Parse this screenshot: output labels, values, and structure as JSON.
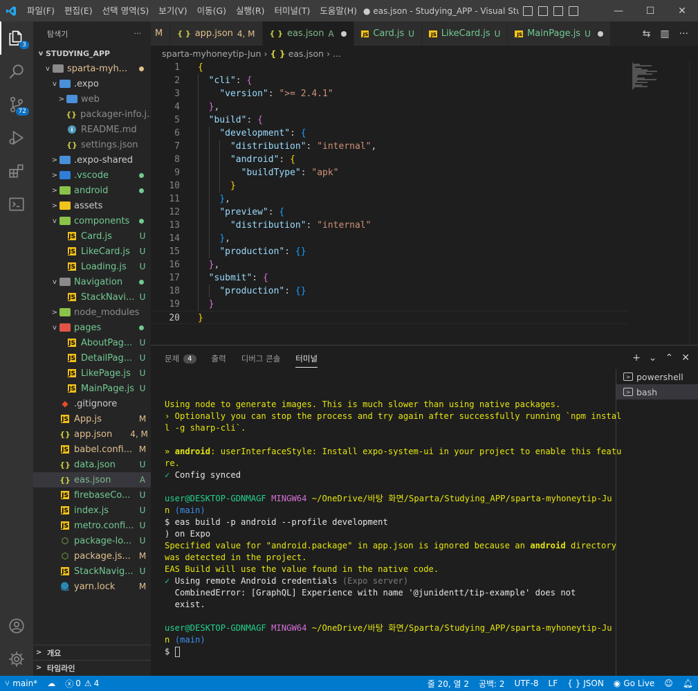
{
  "titlebar": {
    "menu": [
      "파일(F)",
      "편집(E)",
      "선택 영역(S)",
      "보기(V)",
      "이동(G)",
      "실행(R)",
      "터미널(T)",
      "도움말(H)"
    ],
    "window_title": "● eas.json - Studying_APP - Visual Studio C..."
  },
  "activity": {
    "explorer_badge": "3",
    "scm_badge": "72"
  },
  "sidebar": {
    "title": "탐색기",
    "more": "···",
    "project": "STUDYING_APP",
    "items": [
      {
        "twist": "v",
        "icon": "folder",
        "color": "#8a8a8a",
        "label": "sparta-myh...",
        "status": "",
        "dot": "#e2c08d",
        "indent": 1,
        "cls": "c-mod"
      },
      {
        "twist": "v",
        "icon": "folder",
        "color": "#4a90d9",
        "label": ".expo",
        "status": "",
        "indent": 2,
        "cls": "c-white"
      },
      {
        "twist": ">",
        "icon": "folder",
        "color": "#4a90d9",
        "label": "web",
        "status": "",
        "indent": 3,
        "cls": "c-gray"
      },
      {
        "twist": "",
        "icon": "json",
        "label": "packager-info.j...",
        "status": "",
        "indent": 3,
        "cls": "c-gray"
      },
      {
        "twist": "",
        "icon": "info",
        "label": "README.md",
        "status": "",
        "indent": 3,
        "cls": "c-gray"
      },
      {
        "twist": "",
        "icon": "json",
        "label": "settings.json",
        "status": "",
        "indent": 3,
        "cls": "c-gray"
      },
      {
        "twist": ">",
        "icon": "folder",
        "color": "#4a90d9",
        "label": ".expo-shared",
        "status": "",
        "indent": 2,
        "cls": "c-white"
      },
      {
        "twist": ">",
        "icon": "folder",
        "color": "#2f7ed8",
        "label": ".vscode",
        "status": "",
        "dot": "#73c991",
        "indent": 2,
        "cls": "c-unt"
      },
      {
        "twist": ">",
        "icon": "folder",
        "color": "#8bc34a",
        "label": "android",
        "status": "",
        "dot": "#73c991",
        "indent": 2,
        "cls": "c-unt"
      },
      {
        "twist": ">",
        "icon": "folder",
        "color": "#f1c21b",
        "label": "assets",
        "status": "",
        "indent": 2,
        "cls": "c-white"
      },
      {
        "twist": "v",
        "icon": "folder",
        "color": "#8bc34a",
        "label": "components",
        "status": "",
        "dot": "#73c991",
        "indent": 2,
        "cls": "c-unt"
      },
      {
        "twist": "",
        "icon": "js",
        "label": "Card.js",
        "status": "U",
        "indent": 3,
        "cls": "c-unt"
      },
      {
        "twist": "",
        "icon": "js",
        "label": "LikeCard.js",
        "status": "U",
        "indent": 3,
        "cls": "c-unt"
      },
      {
        "twist": "",
        "icon": "js",
        "label": "Loading.js",
        "status": "U",
        "indent": 3,
        "cls": "c-unt"
      },
      {
        "twist": "v",
        "icon": "folder",
        "color": "#8a8a8a",
        "label": "Navigation",
        "status": "",
        "dot": "#73c991",
        "indent": 2,
        "cls": "c-unt"
      },
      {
        "twist": "",
        "icon": "js",
        "label": "StackNavi...",
        "status": "U",
        "indent": 3,
        "cls": "c-unt"
      },
      {
        "twist": ">",
        "icon": "folder",
        "color": "#8bc34a",
        "label": "node_modules",
        "status": "",
        "indent": 2,
        "cls": "c-gray"
      },
      {
        "twist": "v",
        "icon": "folder",
        "color": "#e05545",
        "label": "pages",
        "status": "",
        "dot": "#73c991",
        "indent": 2,
        "cls": "c-unt"
      },
      {
        "twist": "",
        "icon": "js",
        "label": "AboutPag...",
        "status": "U",
        "indent": 3,
        "cls": "c-unt"
      },
      {
        "twist": "",
        "icon": "js",
        "label": "DetailPag...",
        "status": "U",
        "indent": 3,
        "cls": "c-unt"
      },
      {
        "twist": "",
        "icon": "js",
        "label": "LikePage.js",
        "status": "U",
        "indent": 3,
        "cls": "c-unt"
      },
      {
        "twist": "",
        "icon": "js",
        "label": "MainPage.js",
        "status": "U",
        "indent": 3,
        "cls": "c-unt"
      },
      {
        "twist": "",
        "icon": "git",
        "label": ".gitignore",
        "status": "",
        "indent": 2,
        "cls": "c-white"
      },
      {
        "twist": "",
        "icon": "js",
        "label": "App.js",
        "status": "M",
        "indent": 2,
        "cls": "c-mod"
      },
      {
        "twist": "",
        "icon": "json",
        "label": "app.json",
        "status": "4, M",
        "indent": 2,
        "cls": "c-mod"
      },
      {
        "twist": "",
        "icon": "js",
        "label": "babel.confi...",
        "status": "M",
        "indent": 2,
        "cls": "c-mod"
      },
      {
        "twist": "",
        "icon": "json",
        "label": "data.json",
        "status": "U",
        "indent": 2,
        "cls": "c-unt"
      },
      {
        "twist": "",
        "icon": "json",
        "label": "eas.json",
        "status": "A",
        "indent": 2,
        "cls": "c-add",
        "selected": true
      },
      {
        "twist": "",
        "icon": "js",
        "label": "firebaseCo...",
        "status": "U",
        "indent": 2,
        "cls": "c-unt"
      },
      {
        "twist": "",
        "icon": "js",
        "label": "index.js",
        "status": "U",
        "indent": 2,
        "cls": "c-unt"
      },
      {
        "twist": "",
        "icon": "js",
        "label": "metro.confi...",
        "status": "U",
        "indent": 2,
        "cls": "c-unt"
      },
      {
        "twist": "",
        "icon": "npm",
        "label": "package-lo...",
        "status": "U",
        "indent": 2,
        "cls": "c-unt"
      },
      {
        "twist": "",
        "icon": "npm",
        "label": "package.js...",
        "status": "M",
        "indent": 2,
        "cls": "c-mod"
      },
      {
        "twist": "",
        "icon": "js",
        "label": "StackNavig...",
        "status": "U",
        "indent": 2,
        "cls": "c-unt"
      },
      {
        "twist": "",
        "icon": "yarn",
        "label": "yarn.lock",
        "status": "M",
        "indent": 2,
        "cls": "c-mod"
      }
    ],
    "outline": "개요",
    "timeline": "타임라인"
  },
  "tabs": [
    {
      "icon": "",
      "label": "M",
      "status": "",
      "cls": "c-mod",
      "partial": true
    },
    {
      "icon": "{ }",
      "label": "app.json",
      "status": "4, M",
      "cls": "c-mod"
    },
    {
      "icon": "{ }",
      "label": "eas.json",
      "status": "A",
      "cls": "c-add",
      "active": true,
      "dirty": true
    },
    {
      "icon": "JS",
      "label": "Card.js",
      "status": "U",
      "cls": "c-unt"
    },
    {
      "icon": "JS",
      "label": "LikeCard.js",
      "status": "U",
      "cls": "c-unt"
    },
    {
      "icon": "JS",
      "label": "MainPage.js",
      "status": "U",
      "cls": "c-unt",
      "dirty": true
    }
  ],
  "breadcrumb": {
    "folder": "sparta-myhoneytip-Jun",
    "file": "eas.json",
    "more": "..."
  },
  "editor": {
    "current_line": 20,
    "lines": [
      [
        [
          "b1",
          "{"
        ]
      ],
      [
        [
          "p",
          "  "
        ],
        [
          "k",
          "\"cli\""
        ],
        [
          "p",
          ": "
        ],
        [
          "b2",
          "{"
        ]
      ],
      [
        [
          "p",
          "    "
        ],
        [
          "k",
          "\"version\""
        ],
        [
          "p",
          ": "
        ],
        [
          "s",
          "\">= 2.4.1\""
        ]
      ],
      [
        [
          "p",
          "  "
        ],
        [
          "b2",
          "}"
        ],
        [
          "p",
          ","
        ]
      ],
      [
        [
          "p",
          "  "
        ],
        [
          "k",
          "\"build\""
        ],
        [
          "p",
          ": "
        ],
        [
          "b2",
          "{"
        ]
      ],
      [
        [
          "p",
          "    "
        ],
        [
          "k",
          "\"development\""
        ],
        [
          "p",
          ": "
        ],
        [
          "b3",
          "{"
        ]
      ],
      [
        [
          "p",
          "      "
        ],
        [
          "k",
          "\"distribution\""
        ],
        [
          "p",
          ": "
        ],
        [
          "s",
          "\"internal\""
        ],
        [
          "p",
          ","
        ]
      ],
      [
        [
          "p",
          "      "
        ],
        [
          "k",
          "\"android\""
        ],
        [
          "p",
          ": "
        ],
        [
          "b1",
          "{"
        ]
      ],
      [
        [
          "p",
          "        "
        ],
        [
          "k",
          "\"buildType\""
        ],
        [
          "p",
          ": "
        ],
        [
          "s",
          "\"apk\""
        ]
      ],
      [
        [
          "p",
          "      "
        ],
        [
          "b1",
          "}"
        ]
      ],
      [
        [
          "p",
          "    "
        ],
        [
          "b3",
          "}"
        ],
        [
          "p",
          ","
        ]
      ],
      [
        [
          "p",
          "    "
        ],
        [
          "k",
          "\"preview\""
        ],
        [
          "p",
          ": "
        ],
        [
          "b3",
          "{"
        ]
      ],
      [
        [
          "p",
          "      "
        ],
        [
          "k",
          "\"distribution\""
        ],
        [
          "p",
          ": "
        ],
        [
          "s",
          "\"internal\""
        ]
      ],
      [
        [
          "p",
          "    "
        ],
        [
          "b3",
          "}"
        ],
        [
          "p",
          ","
        ]
      ],
      [
        [
          "p",
          "    "
        ],
        [
          "k",
          "\"production\""
        ],
        [
          "p",
          ": "
        ],
        [
          "b3",
          "{}"
        ]
      ],
      [
        [
          "p",
          "  "
        ],
        [
          "b2",
          "}"
        ],
        [
          "p",
          ","
        ]
      ],
      [
        [
          "p",
          "  "
        ],
        [
          "k",
          "\"submit\""
        ],
        [
          "p",
          ": "
        ],
        [
          "b2",
          "{"
        ]
      ],
      [
        [
          "p",
          "    "
        ],
        [
          "k",
          "\"production\""
        ],
        [
          "p",
          ": "
        ],
        [
          "b3",
          "{}"
        ]
      ],
      [
        [
          "p",
          "  "
        ],
        [
          "b2",
          "}"
        ]
      ],
      [
        [
          "b1",
          "}"
        ]
      ]
    ]
  },
  "panel": {
    "tabs": [
      "문제",
      "출력",
      "디버그 콘솔",
      "터미널"
    ],
    "problems_count": "4",
    "terminals": [
      "powershell",
      "bash"
    ],
    "terminal_lines": [
      [],
      [
        [
          "ty",
          "Using node to generate images. This is much slower than using native packages."
        ]
      ],
      [
        [
          "ty",
          "› Optionally you can stop the process and try again after successfully running `npm instal"
        ]
      ],
      [
        [
          "ty",
          "l -g sharp-cli`."
        ]
      ],
      [],
      [
        [
          "ty",
          "» "
        ],
        [
          "ty bold",
          "android"
        ],
        [
          "ty",
          ": userInterfaceStyle: Install expo-system-ui in your project to enable this featu"
        ]
      ],
      [
        [
          "ty",
          "re."
        ]
      ],
      [
        [
          "tg",
          "✓ "
        ],
        [
          "tw",
          "Config synced"
        ]
      ],
      [],
      [
        [
          "tg",
          "user@DESKTOP-GDNMAGF "
        ],
        [
          "tm",
          "MINGW64 "
        ],
        [
          "ty",
          "~/OneDrive/바탕 화면/Sparta/Studying_APP/sparta-myhoneytip-Ju"
        ]
      ],
      [
        [
          "ty",
          "n "
        ],
        [
          "tb",
          "(main)"
        ]
      ],
      [
        [
          "tw",
          "$ eas build -p android --profile development"
        ]
      ],
      [
        [
          "tw",
          ") on Expo"
        ]
      ],
      [
        [
          "ty",
          "Specified value for \"android.package\" in app.json is ignored because an "
        ],
        [
          "ty bold",
          "android"
        ],
        [
          "ty",
          " directory"
        ]
      ],
      [
        [
          "ty",
          "was detected in the project."
        ]
      ],
      [
        [
          "ty",
          "EAS Build will use the value found in the native code."
        ]
      ],
      [
        [
          "tg",
          "✓ "
        ],
        [
          "tw",
          "Using remote Android credentials "
        ],
        [
          "tgr",
          "(Expo server)"
        ]
      ],
      [
        [
          "tw",
          "  CombinedError: [GraphQL] Experience with name '@junidentt/tip-example' does not"
        ]
      ],
      [
        [
          "tw",
          "  exist."
        ]
      ],
      [],
      [
        [
          "tg",
          "user@DESKTOP-GDNMAGF "
        ],
        [
          "tm",
          "MINGW64 "
        ],
        [
          "ty",
          "~/OneDrive/바탕 화면/Sparta/Studying_APP/sparta-myhoneytip-Ju"
        ]
      ],
      [
        [
          "ty",
          "n "
        ],
        [
          "tb",
          "(main)"
        ]
      ],
      [
        [
          "tw",
          "$ "
        ],
        [
          "cursor",
          ""
        ]
      ]
    ]
  },
  "statusbar": {
    "branch": "main*",
    "errors": "0",
    "warnings": "4",
    "position": "줄 20, 열 2",
    "spaces": "공백: 2",
    "encoding": "UTF-8",
    "eol": "LF",
    "language": "JSON",
    "golive": "Go Live"
  },
  "colors": {
    "statusbar": "#007acc",
    "activitybar": "#333333",
    "sidebar": "#252526",
    "editor": "#1e1e1e"
  }
}
